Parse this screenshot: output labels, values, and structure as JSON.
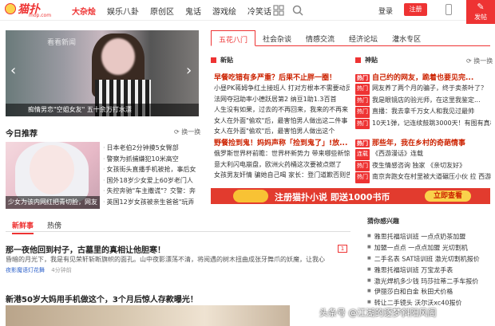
{
  "header": {
    "logo_text": "猫扑",
    "logo_sub": "mop.com",
    "nav": [
      "大杂烩",
      "娱乐八卦",
      "原创区",
      "鬼话",
      "游戏绘",
      "冷笑话"
    ],
    "login": "登录",
    "register": "注册",
    "post": "发帖"
  },
  "slider": {
    "watermark": "看看新闻",
    "caption": "痴情男恋\"空姐女友\" 五十余万打水漂"
  },
  "today": {
    "title": "今日推荐",
    "refresh": "换一换",
    "image_caption": "少女为该内网红把青切脸，网友",
    "items": [
      "日本老伯2分钟摸5女臀部",
      "警察为抓捕嫌犯10米高空",
      "女孩街头直播手机被抢，事后女",
      "国外18岁少女爱上60岁老门人",
      "失控奔驰\"车主撒谎\"？交警：奔",
      "英国12岁女孩被亲生爸爸\"玩弄"
    ]
  },
  "tabs": [
    "五花八门",
    "社会杂谈",
    "情感交流",
    "经济论坛",
    "灌水专区"
  ],
  "news": {
    "left_header": "新贴",
    "right_header": "神贴",
    "right_refresh": "换一换",
    "left_headline": "早餐吃错有多严重？后果不止胖一圈！",
    "left_items": [
      "小昼PK蒋姆争红土接班人 打对方根本不需要动员",
      "法网夺冠助率小德跃居第2 纳豆1助1.3百首",
      "人生没有如果，过去的不再回来，我来的不再来",
      "女人在外面\"偷欢\"后，最害怕男人做出这二件事",
      "女人在外面\"偷欢\"后，最害怕男人做出这个"
    ],
    "left_headline2": "野餐捡到鬼！妈妈声称「捡到鬼了」!放...",
    "left_items2": [
      "俄罗斯世界杯前瞻：世界杯新势力 带来哪些新惊喜",
      "意大利闪电崩盘，欧洲火药桶这次要被点燃了",
      "女孩男友奸情 骗她自己喝 家长：登门道歉否则告"
    ],
    "right_headline": "自己约的网友，跪着也要见完...",
    "right_items": [
      "网友养了两个月的骗子，终于卖茶叶了？",
      "我是眼镜店的验光师，在这里我鉴定...",
      "直播：我去拿千万女人和我见过最帅",
      "10天1弹，记连续鼓跳3000天！有图有真相"
    ],
    "right_tags": [
      "热门",
      "热门",
      "热门",
      "热门"
    ],
    "right_headline2": "那些年，我在乡村的奇葩情事",
    "right_items2": [
      "《西游漫话》连载",
      "夜生情感咨询 独家 《亲切友好》",
      "南京奔跑女在村里被大道碾压小伙 拉 西游"
    ],
    "right_tags2": [
      "连载",
      "热门",
      "热门"
    ]
  },
  "banner": {
    "text": "注册猫扑小说 即送1000书币",
    "button": "立即查看"
  },
  "bottom_tabs": [
    "新鲜事",
    "热傍"
  ],
  "article": {
    "title": "那一夜他回到村子，古墓里的真相让他胆寒！",
    "summary": "昏暗的月光下，我是有见荣轩斩断旗帜的面孔。山中夜影漂荡不清，将阅遇的树木扭曲成张牙舞爪的妖魔，让我心",
    "source": "夜影魔语灯花舞",
    "time": "4分钟前",
    "comments": "1"
  },
  "article2": {
    "title": "新港50岁大妈用手机做这个，3个月后惊人存款曝光！"
  },
  "interest": {
    "title": "猜你感兴趣",
    "items": [
      "雅思托福培训班 一点点奶茶加盟",
      "加盟一点点 一点点加盟 光切割机",
      "二手名表 SAT培训班 激光切割机报价",
      "雅思托福培训班 万宝龙手表",
      "激光焊机多少钱 玛莎拉蒂二手车报价",
      "伊丽莎白和白金 秋田犬价格",
      "转让二手镜头 沃尔沃xc40报价"
    ]
  },
  "watermark": "头条号 @江湖的逐梦斜阳风阁"
}
